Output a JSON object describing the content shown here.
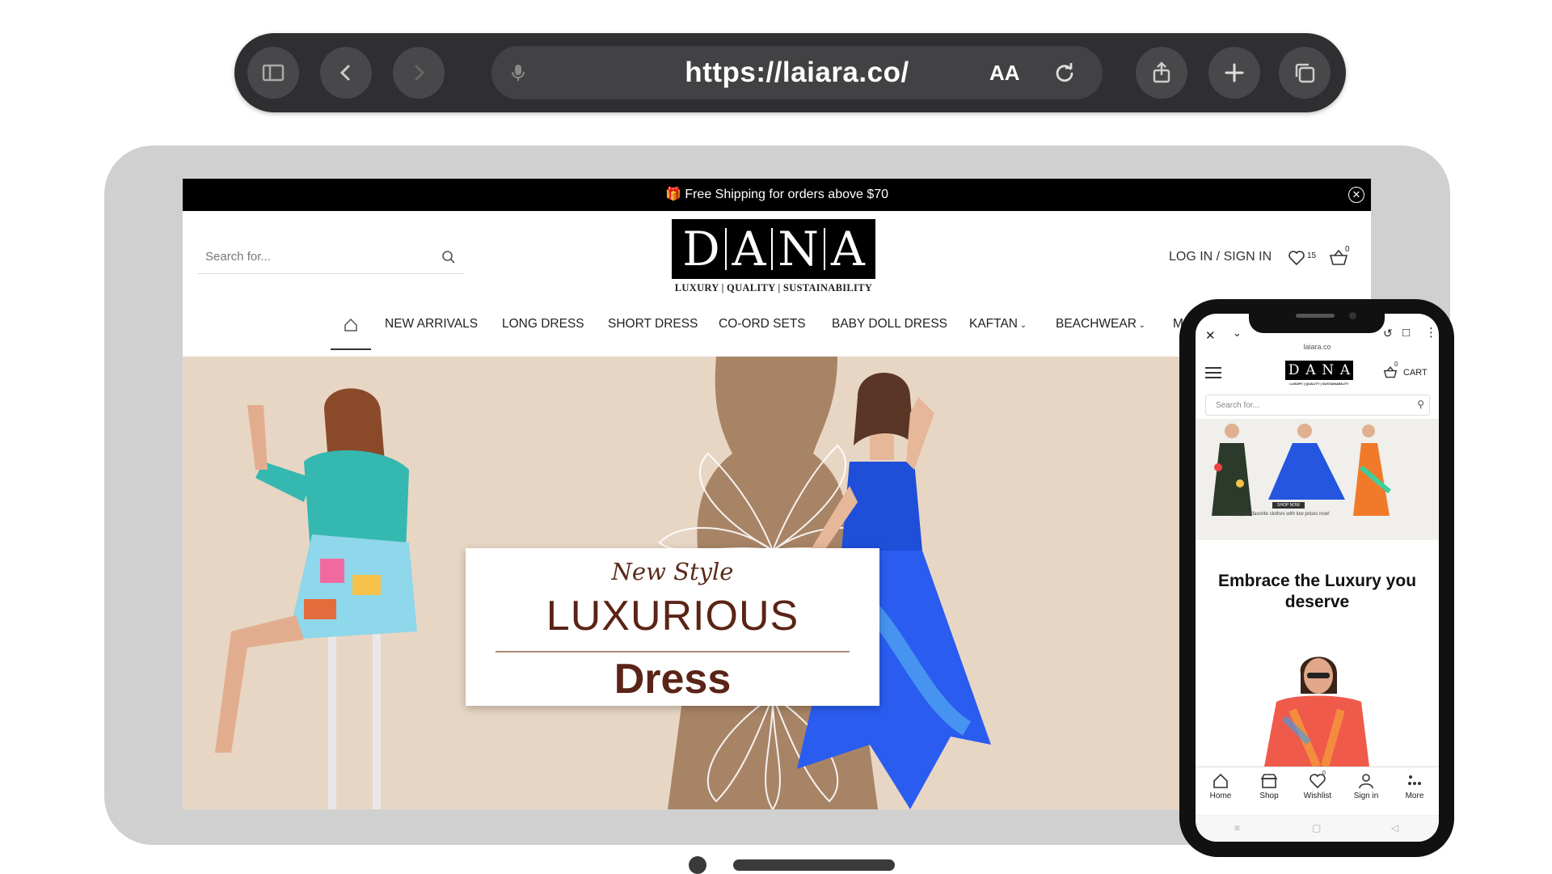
{
  "browser": {
    "url": "https://laiara.co/",
    "text_size_label": "AA"
  },
  "site": {
    "promo": "Free Shipping for orders above $70",
    "search_placeholder": "Search for...",
    "logo_letters": [
      "D",
      "A",
      "N",
      "A"
    ],
    "logo_tagline": "LUXURY | QUALITY | SUSTAINABILITY",
    "login": "LOG IN / SIGN IN",
    "wishlist_count": "15",
    "cart_count": "0",
    "nav": [
      "NEW ARRIVALS",
      "LONG DRESS",
      "SHORT DRESS",
      "CO-ORD SETS",
      "BABY DOLL DRESS",
      "KAFTAN",
      "BEACHWEAR",
      "MI"
    ],
    "hero": {
      "line1": "New Style",
      "line2": "LUXURIOUS",
      "line3": "Dress"
    }
  },
  "phone": {
    "domain": "laiara.co",
    "cart": "CART",
    "cart_count": "0",
    "search_placeholder": "Search for...",
    "shop_now": "SHOP NOW",
    "hero_caption": "Grab your favorite clothes  with low prices now!",
    "heading": "Embrace the Luxury you deserve",
    "wishlist_count": "0",
    "tabs": [
      "Home",
      "Shop",
      "Wishlist",
      "Sign in",
      "More"
    ]
  },
  "colors": {
    "hero_bg": "#e8d6c4",
    "accent_text": "#5a2416",
    "dress_blue": "#1f4fd8",
    "shirt_teal": "#35b8b0"
  }
}
